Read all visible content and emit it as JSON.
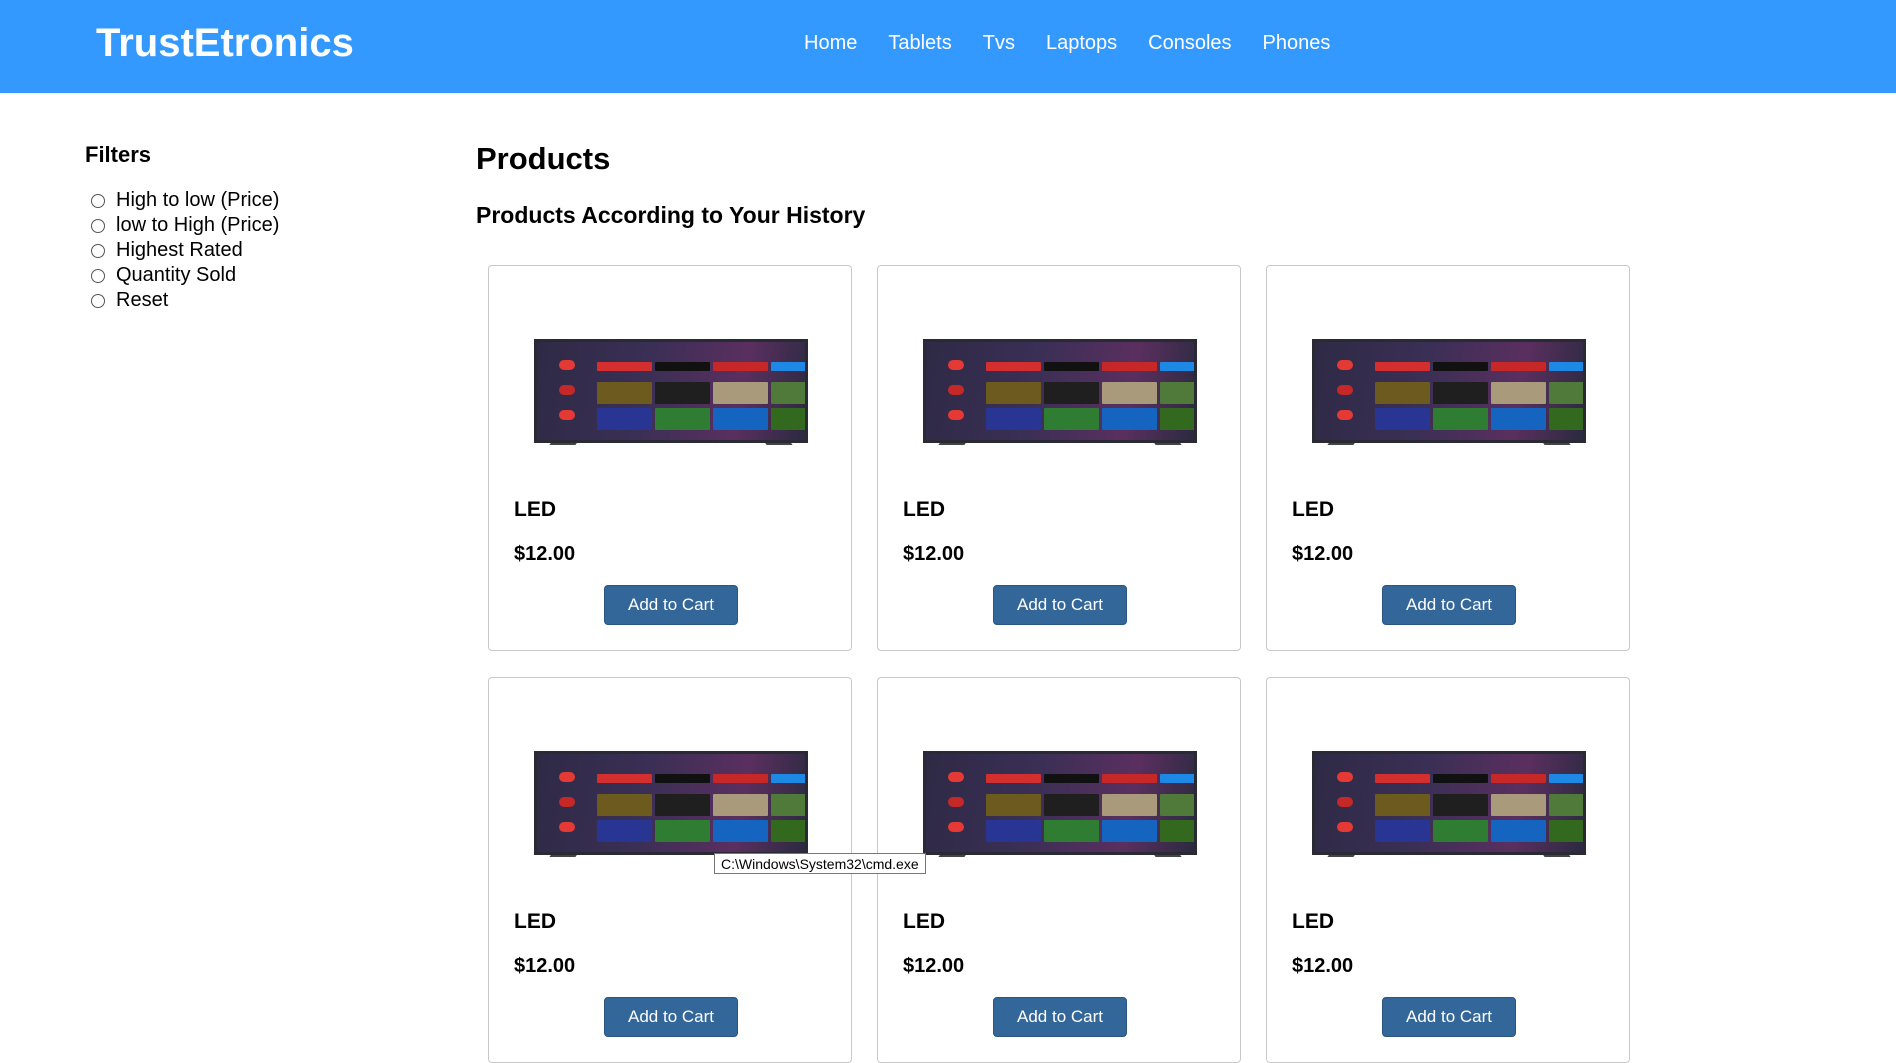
{
  "brand": {
    "name": "TrustEtronics"
  },
  "nav": {
    "links": [
      "Home",
      "Tablets",
      "Tvs",
      "Laptops",
      "Consoles",
      "Phones"
    ]
  },
  "filters": {
    "title": "Filters",
    "options": [
      "High to low (Price)",
      "low to High (Price)",
      "Highest Rated",
      "Quantity Sold",
      "Reset"
    ]
  },
  "products": {
    "title": "Products",
    "subtitle": "Products According to Your History",
    "items": [
      {
        "name": "LED",
        "price": "$12.00",
        "button": "Add to Cart"
      },
      {
        "name": "LED",
        "price": "$12.00",
        "button": "Add to Cart"
      },
      {
        "name": "LED",
        "price": "$12.00",
        "button": "Add to Cart"
      },
      {
        "name": "LED",
        "price": "$12.00",
        "button": "Add to Cart"
      },
      {
        "name": "LED",
        "price": "$12.00",
        "button": "Add to Cart"
      },
      {
        "name": "LED",
        "price": "$12.00",
        "button": "Add to Cart"
      }
    ]
  },
  "tooltip": {
    "text": "C:\\Windows\\System32\\cmd.exe"
  },
  "colors": {
    "navbar": "#3399ff",
    "button": "#336699"
  }
}
